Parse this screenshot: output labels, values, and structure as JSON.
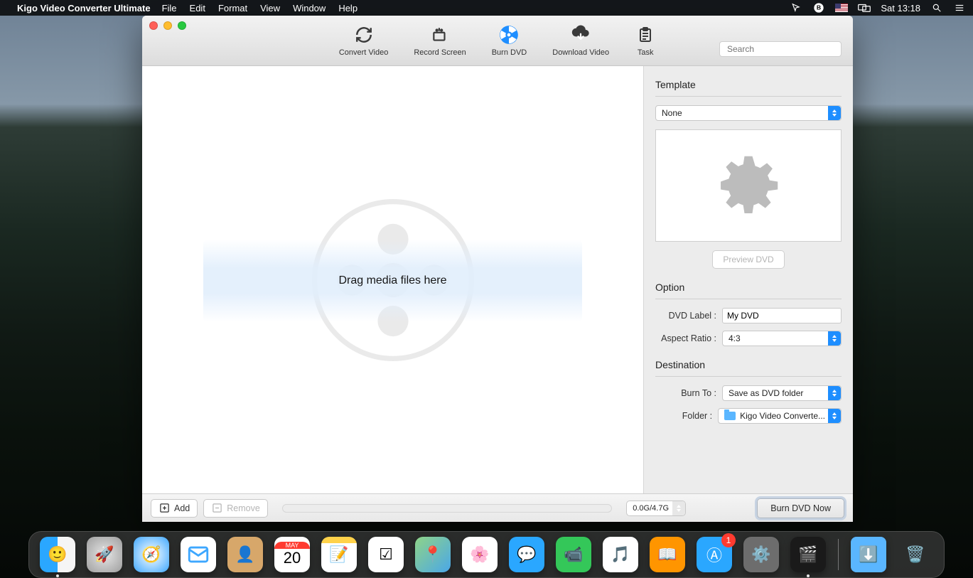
{
  "menubar": {
    "app_name": "Kigo Video Converter Ultimate",
    "items": [
      "File",
      "Edit",
      "Format",
      "View",
      "Window",
      "Help"
    ],
    "clock": "Sat 13:18"
  },
  "toolbar": {
    "items": [
      {
        "label": "Convert Video"
      },
      {
        "label": "Record Screen"
      },
      {
        "label": "Burn DVD"
      },
      {
        "label": "Download Video"
      },
      {
        "label": "Task"
      }
    ],
    "search_placeholder": "Search"
  },
  "dropzone": {
    "text": "Drag media files here"
  },
  "panel": {
    "template_title": "Template",
    "template_value": "None",
    "preview_btn": "Preview DVD",
    "option_title": "Option",
    "dvd_label_lbl": "DVD Label :",
    "dvd_label_value": "My DVD",
    "aspect_lbl": "Aspect Ratio :",
    "aspect_value": "4:3",
    "destination_title": "Destination",
    "burnto_lbl": "Burn To :",
    "burnto_value": "Save as DVD folder",
    "folder_lbl": "Folder  :",
    "folder_value": "Kigo Video Converte..."
  },
  "footer": {
    "add": "Add",
    "remove": "Remove",
    "size": "0.0G/4.7G",
    "burn_now": "Burn DVD Now"
  },
  "dock": {
    "badge": "1"
  }
}
